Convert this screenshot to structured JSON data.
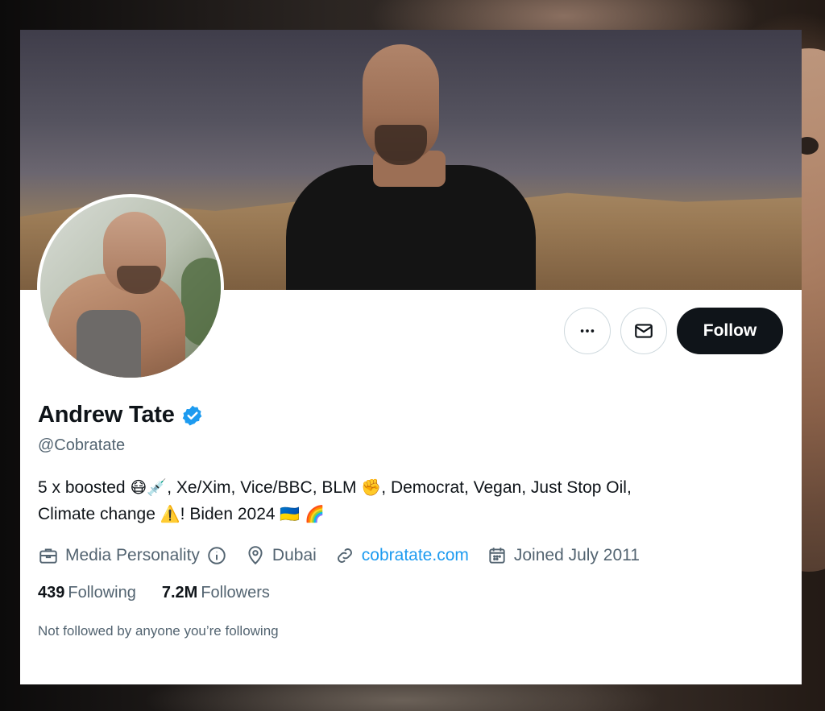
{
  "profile": {
    "name": "Andrew Tate",
    "handle": "@Cobratate",
    "verified": true,
    "bio": {
      "part1": "5 x boosted ",
      "emoji_mask": "😷",
      "emoji_syringe": "💉",
      "part2": ", Xe/Xim, Vice/BBC, BLM ",
      "emoji_fist": "✊",
      "part3": ", Democrat, Vegan, Just Stop Oil,",
      "part4": "Climate change ",
      "emoji_warning": "⚠️",
      "part5": "! Biden 2024 ",
      "emoji_flag": "🇺🇦",
      "emoji_rainbow": "🌈"
    },
    "meta": {
      "category": "Media Personality",
      "location": "Dubai",
      "website": "cobratate.com",
      "joined": "Joined July 2011"
    },
    "stats": {
      "following_count": "439",
      "following_label": "Following",
      "followers_count": "7.2M",
      "followers_label": "Followers"
    },
    "note": "Not followed by anyone you’re following"
  },
  "actions": {
    "more_icon": "more-horizontal-icon",
    "message_icon": "envelope-icon",
    "follow_label": "Follow"
  },
  "colors": {
    "text_primary": "#0f1419",
    "text_secondary": "#536471",
    "link": "#1d9bf0",
    "follow_bg": "#0f1419",
    "verified": "#1d9bf0"
  }
}
